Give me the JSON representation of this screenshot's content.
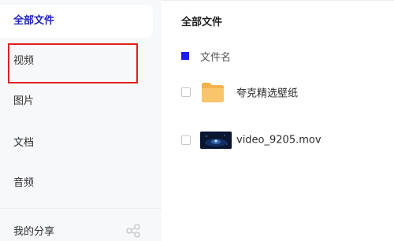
{
  "sidebar": {
    "items": [
      {
        "label": "全部文件",
        "active": true
      },
      {
        "label": "视频",
        "highlighted": true
      },
      {
        "label": "图片"
      },
      {
        "label": "文档"
      },
      {
        "label": "音频"
      },
      {
        "label": "我的分享",
        "icon": "share-icon"
      }
    ]
  },
  "main": {
    "title": "全部文件",
    "header": {
      "column_label": "文件名"
    },
    "files": [
      {
        "name": "夸克精选壁纸",
        "type": "folder",
        "icon": "folder-icon"
      },
      {
        "name": "video_9205.mov",
        "type": "video",
        "icon": "video-thumbnail"
      }
    ]
  },
  "colors": {
    "accent": "#1f1fbf",
    "highlight_box": "#e02020",
    "folder": "#f7b955",
    "sidebar_bg": "#f7f8fa"
  }
}
